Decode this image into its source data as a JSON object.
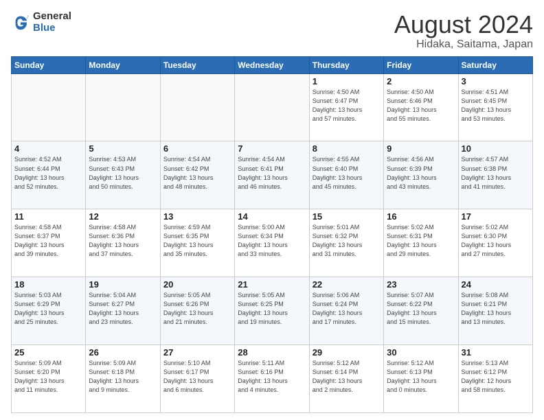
{
  "logo": {
    "general": "General",
    "blue": "Blue"
  },
  "title": "August 2024",
  "subtitle": "Hidaka, Saitama, Japan",
  "weekdays": [
    "Sunday",
    "Monday",
    "Tuesday",
    "Wednesday",
    "Thursday",
    "Friday",
    "Saturday"
  ],
  "weeks": [
    [
      {
        "day": "",
        "info": ""
      },
      {
        "day": "",
        "info": ""
      },
      {
        "day": "",
        "info": ""
      },
      {
        "day": "",
        "info": ""
      },
      {
        "day": "1",
        "info": "Sunrise: 4:50 AM\nSunset: 6:47 PM\nDaylight: 13 hours\nand 57 minutes."
      },
      {
        "day": "2",
        "info": "Sunrise: 4:50 AM\nSunset: 6:46 PM\nDaylight: 13 hours\nand 55 minutes."
      },
      {
        "day": "3",
        "info": "Sunrise: 4:51 AM\nSunset: 6:45 PM\nDaylight: 13 hours\nand 53 minutes."
      }
    ],
    [
      {
        "day": "4",
        "info": "Sunrise: 4:52 AM\nSunset: 6:44 PM\nDaylight: 13 hours\nand 52 minutes."
      },
      {
        "day": "5",
        "info": "Sunrise: 4:53 AM\nSunset: 6:43 PM\nDaylight: 13 hours\nand 50 minutes."
      },
      {
        "day": "6",
        "info": "Sunrise: 4:54 AM\nSunset: 6:42 PM\nDaylight: 13 hours\nand 48 minutes."
      },
      {
        "day": "7",
        "info": "Sunrise: 4:54 AM\nSunset: 6:41 PM\nDaylight: 13 hours\nand 46 minutes."
      },
      {
        "day": "8",
        "info": "Sunrise: 4:55 AM\nSunset: 6:40 PM\nDaylight: 13 hours\nand 45 minutes."
      },
      {
        "day": "9",
        "info": "Sunrise: 4:56 AM\nSunset: 6:39 PM\nDaylight: 13 hours\nand 43 minutes."
      },
      {
        "day": "10",
        "info": "Sunrise: 4:57 AM\nSunset: 6:38 PM\nDaylight: 13 hours\nand 41 minutes."
      }
    ],
    [
      {
        "day": "11",
        "info": "Sunrise: 4:58 AM\nSunset: 6:37 PM\nDaylight: 13 hours\nand 39 minutes."
      },
      {
        "day": "12",
        "info": "Sunrise: 4:58 AM\nSunset: 6:36 PM\nDaylight: 13 hours\nand 37 minutes."
      },
      {
        "day": "13",
        "info": "Sunrise: 4:59 AM\nSunset: 6:35 PM\nDaylight: 13 hours\nand 35 minutes."
      },
      {
        "day": "14",
        "info": "Sunrise: 5:00 AM\nSunset: 6:34 PM\nDaylight: 13 hours\nand 33 minutes."
      },
      {
        "day": "15",
        "info": "Sunrise: 5:01 AM\nSunset: 6:32 PM\nDaylight: 13 hours\nand 31 minutes."
      },
      {
        "day": "16",
        "info": "Sunrise: 5:02 AM\nSunset: 6:31 PM\nDaylight: 13 hours\nand 29 minutes."
      },
      {
        "day": "17",
        "info": "Sunrise: 5:02 AM\nSunset: 6:30 PM\nDaylight: 13 hours\nand 27 minutes."
      }
    ],
    [
      {
        "day": "18",
        "info": "Sunrise: 5:03 AM\nSunset: 6:29 PM\nDaylight: 13 hours\nand 25 minutes."
      },
      {
        "day": "19",
        "info": "Sunrise: 5:04 AM\nSunset: 6:27 PM\nDaylight: 13 hours\nand 23 minutes."
      },
      {
        "day": "20",
        "info": "Sunrise: 5:05 AM\nSunset: 6:26 PM\nDaylight: 13 hours\nand 21 minutes."
      },
      {
        "day": "21",
        "info": "Sunrise: 5:05 AM\nSunset: 6:25 PM\nDaylight: 13 hours\nand 19 minutes."
      },
      {
        "day": "22",
        "info": "Sunrise: 5:06 AM\nSunset: 6:24 PM\nDaylight: 13 hours\nand 17 minutes."
      },
      {
        "day": "23",
        "info": "Sunrise: 5:07 AM\nSunset: 6:22 PM\nDaylight: 13 hours\nand 15 minutes."
      },
      {
        "day": "24",
        "info": "Sunrise: 5:08 AM\nSunset: 6:21 PM\nDaylight: 13 hours\nand 13 minutes."
      }
    ],
    [
      {
        "day": "25",
        "info": "Sunrise: 5:09 AM\nSunset: 6:20 PM\nDaylight: 13 hours\nand 11 minutes."
      },
      {
        "day": "26",
        "info": "Sunrise: 5:09 AM\nSunset: 6:18 PM\nDaylight: 13 hours\nand 9 minutes."
      },
      {
        "day": "27",
        "info": "Sunrise: 5:10 AM\nSunset: 6:17 PM\nDaylight: 13 hours\nand 6 minutes."
      },
      {
        "day": "28",
        "info": "Sunrise: 5:11 AM\nSunset: 6:16 PM\nDaylight: 13 hours\nand 4 minutes."
      },
      {
        "day": "29",
        "info": "Sunrise: 5:12 AM\nSunset: 6:14 PM\nDaylight: 13 hours\nand 2 minutes."
      },
      {
        "day": "30",
        "info": "Sunrise: 5:12 AM\nSunset: 6:13 PM\nDaylight: 13 hours\nand 0 minutes."
      },
      {
        "day": "31",
        "info": "Sunrise: 5:13 AM\nSunset: 6:12 PM\nDaylight: 12 hours\nand 58 minutes."
      }
    ]
  ]
}
